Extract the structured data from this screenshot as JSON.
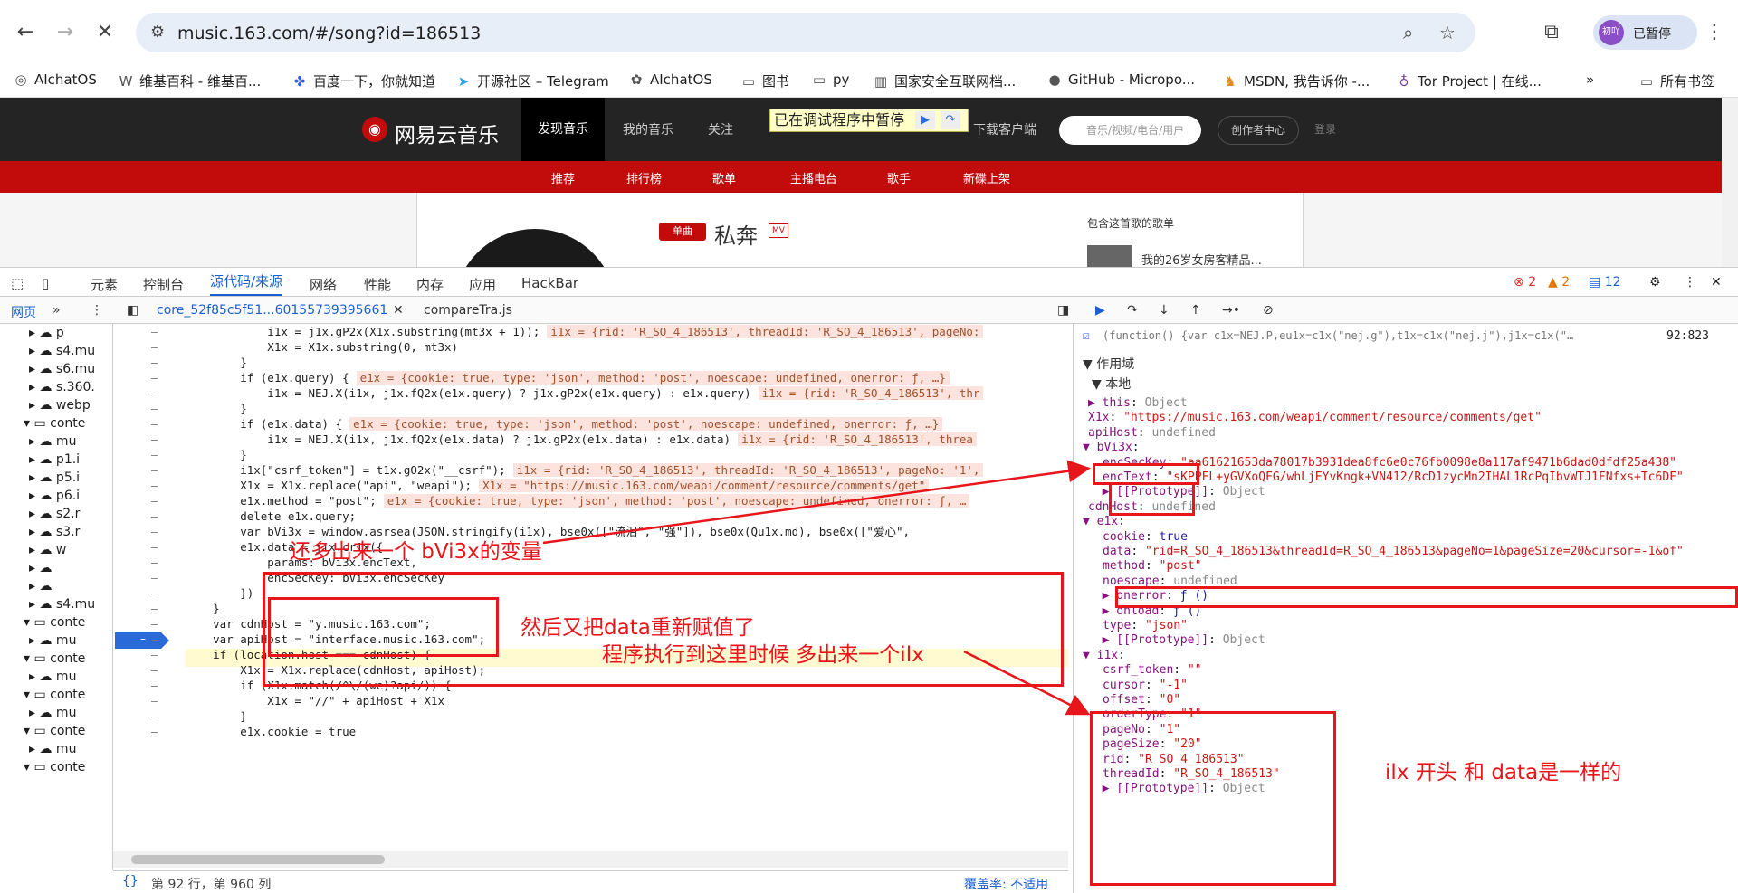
{
  "browser": {
    "url": "music.163.com/#/song?id=186513",
    "profile_initials": "初吖",
    "profile_label": "已暂停",
    "bookmarks": [
      "AIchatOS",
      "维基百科 - 维基百...",
      "百度一下，你就知道",
      "开源社区 – Telegram",
      "AIchatOS",
      "图书",
      "py",
      "国家安全互联网档...",
      "GitHub - Micropo...",
      "MSDN, 我告诉你 -...",
      "Tor Project | 在线..."
    ],
    "all_bookmarks": "所有书签",
    "overflow": "»"
  },
  "site": {
    "logo_text": "网易云音乐",
    "nav": [
      "发现音乐",
      "我的音乐",
      "关注",
      "下载客户端"
    ],
    "paused_banner": "已在调试程序中暂停",
    "search_placeholder": "音乐/视频/电台/用户",
    "creator_btn": "创作者中心",
    "login": "登录",
    "subnav": [
      "推荐",
      "排行榜",
      "歌单",
      "主播电台",
      "歌手",
      "新碟上架"
    ],
    "single_tag": "单曲",
    "song_title": "私奔",
    "mv_label": "MV",
    "playlist_heading": "包含这首歌的歌单",
    "playlist_item": "我的26岁女房客精品..."
  },
  "devtools": {
    "tabs": [
      "元素",
      "控制台",
      "源代码/来源",
      "网络",
      "性能",
      "内存",
      "应用",
      "HackBar"
    ],
    "errors": "2",
    "warnings": "2",
    "messages": "12",
    "nav_tab": "网页",
    "file_tabs": [
      "core_52f85c5f51...60155739395661",
      "compareTra.js"
    ],
    "status_position": "第 92 行，第 960 列",
    "coverage": "覆盖率: 不适用",
    "call_frame": "(function() {var c1x=NEJ.P,eu1x=c1x(\"nej.g\"),t1x=c1x(\"nej.j\"),j1x=c1x(\"…",
    "call_pos": "92:823",
    "scope_label": "作用域",
    "local_label": "本地"
  },
  "tree": [
    "p",
    "s4.mu",
    "s6.mu",
    "s.360.",
    "webp",
    "conte",
    "mu",
    "p1.i",
    "p5.i",
    "p6.i",
    "s2.r",
    "s3.r",
    "w",
    "",
    "",
    "s4.mu",
    "conte",
    "mu",
    "conte",
    "mu",
    "conte",
    "mu",
    "conte",
    "mu",
    "conte"
  ],
  "code": [
    {
      "t": "        i1x = j1x.gP2x(X1x.substring(mt3x + 1));",
      "v": "i1x = {rid: 'R_SO_4_186513', threadId: 'R_SO_4_186513', pageNo:"
    },
    {
      "t": "        X1x = X1x.substring(0, mt3x)",
      "v": ""
    },
    {
      "t": "    }",
      "v": ""
    },
    {
      "t": "    if (e1x.query) {",
      "v": "e1x = {cookie: true, type: 'json', method: 'post', noescape: undefined, onerror: ƒ, …}"
    },
    {
      "t": "        i1x = NEJ.X(i1x, j1x.fQ2x(e1x.query) ? j1x.gP2x(e1x.query) : e1x.query)",
      "v": "i1x = {rid: 'R_SO_4_186513', thr"
    },
    {
      "t": "    }",
      "v": ""
    },
    {
      "t": "    if (e1x.data) {",
      "v": "e1x = {cookie: true, type: 'json', method: 'post', noescape: undefined, onerror: ƒ, …}"
    },
    {
      "t": "        i1x = NEJ.X(i1x, j1x.fQ2x(e1x.data) ? j1x.gP2x(e1x.data) : e1x.data)",
      "v": "i1x = {rid: 'R_SO_4_186513', threa"
    },
    {
      "t": "    }",
      "v": ""
    },
    {
      "t": "    i1x[\"csrf_token\"] = t1x.gO2x(\"__csrf\");",
      "v": "i1x = {rid: 'R_SO_4_186513', threadId: 'R_SO_4_186513', pageNo: '1',"
    },
    {
      "t": "    X1x = X1x.replace(\"api\", \"weapi\");",
      "v": "X1x = \"https://music.163.com/weapi/comment/resource/comments/get\""
    },
    {
      "t": "    e1x.method = \"post\";",
      "v": "e1x = {cookie: true, type: 'json', method: 'post', noescape: undefined, onerror: ƒ, …"
    },
    {
      "t": "    delete e1x.query;",
      "v": ""
    },
    {
      "t": "    var bVi3x = window.asrsea(JSON.stringify(i1x), bse0x([\"流泪\", \"强\"]), bse0x(Qu1x.md), bse0x([\"爱心\",",
      "v": ""
    },
    {
      "t": "    e1x.data = j1x.cr1x({",
      "v": ""
    },
    {
      "t": "        params: bVi3x.encText,",
      "v": ""
    },
    {
      "t": "        encSecKey: bVi3x.encSecKey",
      "v": ""
    },
    {
      "t": "    })",
      "v": ""
    },
    {
      "t": "}",
      "v": ""
    },
    {
      "t": "var cdnHost = \"y.music.163.com\";",
      "v": ""
    },
    {
      "t": "var apiHost = \"interface.music.163.com\";",
      "v": ""
    },
    {
      "t": "if (location.host === cdnHost) {",
      "v": ""
    },
    {
      "t": "    X1x = X1x.replace(cdnHost, apiHost);",
      "v": ""
    },
    {
      "t": "    if (X1x.match(/^\\/(we)?api/)) {",
      "v": ""
    },
    {
      "t": "        X1x = \"//\" + apiHost + X1x",
      "v": ""
    },
    {
      "t": "    }",
      "v": ""
    },
    {
      "t": "    e1x.cookie = true",
      "v": ""
    }
  ],
  "scope": [
    {
      "i": 1,
      "k": "▶ this",
      "v": "Object",
      "c": "gr"
    },
    {
      "i": 1,
      "k": "X1x",
      "v": "\"https://music.163.com/weapi/comment/resource/comments/get\"",
      "c": "sv"
    },
    {
      "i": 1,
      "k": "apiHost",
      "v": "undefined",
      "c": "gr"
    },
    {
      "i": 0,
      "k": "▼ bVi3x",
      "v": "",
      "c": "gr"
    },
    {
      "i": 2,
      "k": "encSecKey",
      "v": "\"aa61621653da78017b3931dea8fc6e0c76fb0098e8a117af9471b6dad0dfdf25a438\"",
      "c": "sv"
    },
    {
      "i": 2,
      "k": "encText",
      "v": "\"sKPPFL+yGVXoQFG/whLjEYvKngk+VN412/RcD1zycMn2IHAL1RcPqIbvWTJ1FNfxs+Tc6DF\"",
      "c": "sv"
    },
    {
      "i": 1,
      "k": "  ▶ [[Prototype]]",
      "v": "Object",
      "c": "gr"
    },
    {
      "i": 1,
      "k": "cdnHost",
      "v": "undefined",
      "c": "gr"
    },
    {
      "i": 0,
      "k": "▼ e1x",
      "v": "",
      "c": "gr"
    },
    {
      "i": 2,
      "k": "cookie",
      "v": "true",
      "c": "nv"
    },
    {
      "i": 2,
      "k": "data",
      "v": "\"rid=R_SO_4_186513&threadId=R_SO_4_186513&pageNo=1&pageSize=20&cursor=-1&of\"",
      "c": "sv"
    },
    {
      "i": 2,
      "k": "method",
      "v": "\"post\"",
      "c": "sv"
    },
    {
      "i": 2,
      "k": "noescape",
      "v": "undefined",
      "c": "gr"
    },
    {
      "i": 1,
      "k": "  ▶ onerror",
      "v": "ƒ ()",
      "c": "nv"
    },
    {
      "i": 1,
      "k": "  ▶ onload",
      "v": "ƒ ()",
      "c": "nv"
    },
    {
      "i": 2,
      "k": "type",
      "v": "\"json\"",
      "c": "sv"
    },
    {
      "i": 1,
      "k": "  ▶ [[Prototype]]",
      "v": "Object",
      "c": "gr"
    },
    {
      "i": 0,
      "k": "▼ i1x",
      "v": "",
      "c": "gr"
    },
    {
      "i": 2,
      "k": "csrf_token",
      "v": "\"\"",
      "c": "sv"
    },
    {
      "i": 2,
      "k": "cursor",
      "v": "\"-1\"",
      "c": "sv"
    },
    {
      "i": 2,
      "k": "offset",
      "v": "\"0\"",
      "c": "sv"
    },
    {
      "i": 2,
      "k": "orderType",
      "v": "\"1\"",
      "c": "sv"
    },
    {
      "i": 2,
      "k": "pageNo",
      "v": "\"1\"",
      "c": "sv"
    },
    {
      "i": 2,
      "k": "pageSize",
      "v": "\"20\"",
      "c": "sv"
    },
    {
      "i": 2,
      "k": "rid",
      "v": "\"R_SO_4_186513\"",
      "c": "sv"
    },
    {
      "i": 2,
      "k": "threadId",
      "v": "\"R_SO_4_186513\"",
      "c": "sv"
    },
    {
      "i": 1,
      "k": "  ▶ [[Prototype]]",
      "v": "Object",
      "c": "gr"
    }
  ],
  "annotations": {
    "a1": "还多出来一个 bVi3x的变量",
    "a2": "然后又把data重新赋值了",
    "a3": "程序执行到这里时候 多出来一个ilx",
    "a4": "ilx 开头 和 data是一样的"
  },
  "colors": {
    "accent": "#c20c0c",
    "annotation": "#e8151b",
    "devtools_blue": "#1a5fd0"
  }
}
